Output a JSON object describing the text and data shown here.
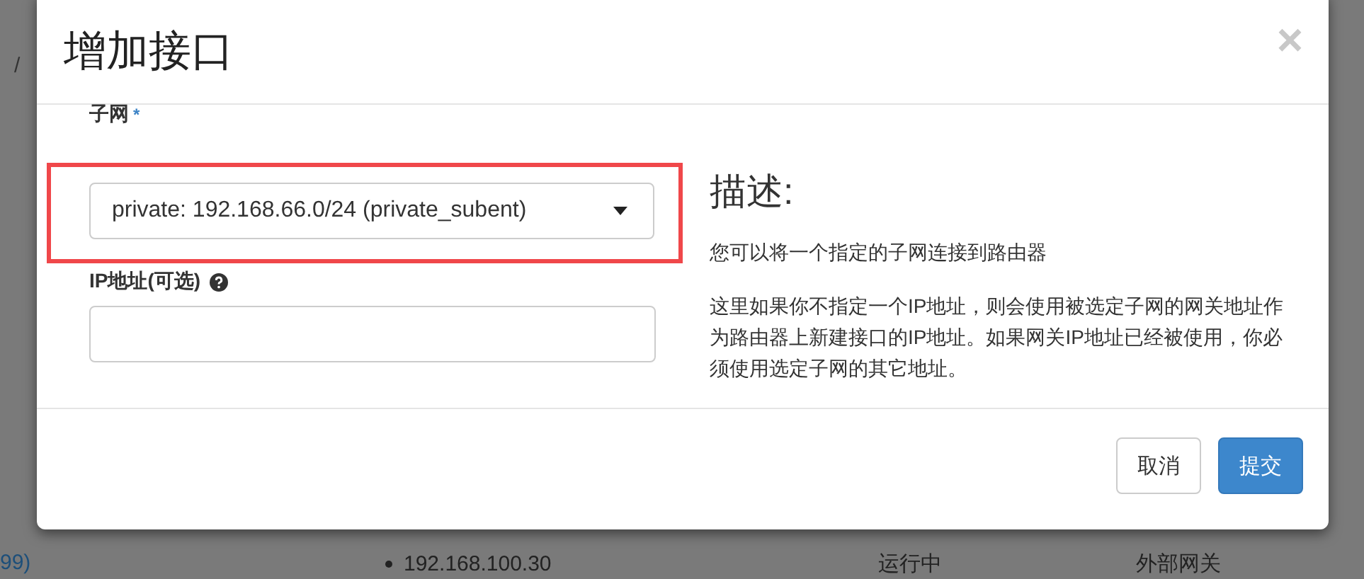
{
  "background_page": {
    "breadcrumb_separator": "/",
    "row": {
      "link": "99)",
      "ip": "192.168.100.30",
      "status": "运行中",
      "type": "外部网关"
    }
  },
  "dialog": {
    "title": "增加接口",
    "close": "×",
    "subnet": {
      "label": "子网",
      "required_mark": "*",
      "value": "private: 192.168.66.0/24 (private_subent)",
      "highlighted": true
    },
    "ip_address": {
      "label": "IP地址(可选)"
    },
    "description": {
      "heading": "描述:",
      "paragraphs": [
        "您可以将一个指定的子网连接到路由器",
        "这里如果你不指定一个IP地址，则会使用被选定子网的网关地址作为路由器上新建接口的IP地址。如果网关IP地址已经被使用，你必须使用选定子网的其它地址。"
      ]
    },
    "buttons": [
      {
        "label": "取消",
        "kind": "default"
      },
      {
        "label": "提交",
        "kind": "primary"
      }
    ]
  }
}
